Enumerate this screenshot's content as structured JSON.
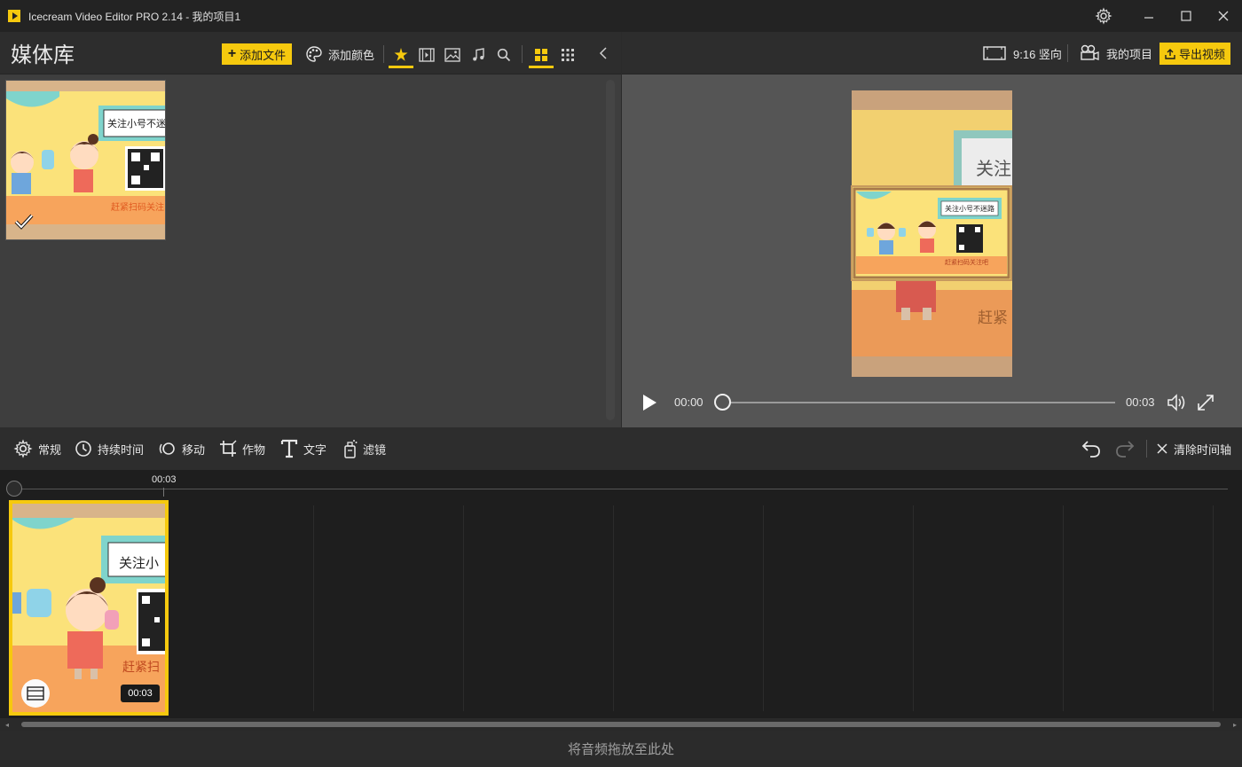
{
  "window": {
    "title": "Icecream Video Editor PRO 2.14 - 我的项目1",
    "controls": [
      "settings",
      "minimize",
      "maximize",
      "close"
    ]
  },
  "library": {
    "title": "媒体库",
    "add_file_label": "添加文件",
    "add_color_label": "添加颜色",
    "filters": [
      "all-star-icon",
      "video-icon",
      "image-icon",
      "music-icon",
      "search-icon"
    ],
    "active_filter": "all-star-icon",
    "views": [
      "large-grid-icon",
      "small-grid-icon"
    ],
    "active_view": "large-grid-icon",
    "items": [
      {
        "caption_top": "关注小号不迷",
        "caption_bottom": "赶紧扫码关注",
        "selected": true
      }
    ]
  },
  "preview": {
    "aspect_label": "9:16 竖向",
    "project_label": "我的项目",
    "export_label": "导出视频",
    "pip_caption_top": "关注小号不迷路",
    "pip_caption_bottom": "赶紧扫码关注吧",
    "bg_caption_top": "关注",
    "bg_caption_bottom": "赶紧",
    "time_current": "00:00",
    "time_total": "00:03",
    "progress": 0
  },
  "toolbar": {
    "general": "常规",
    "duration": "持续时间",
    "motion": "移动",
    "crop": "作物",
    "text": "文字",
    "filter": "滤镜",
    "clear_timeline": "清除时间轴"
  },
  "timeline": {
    "ruler_label": "00:03",
    "clip_caption_top": "关注小",
    "clip_caption_bottom": "赶紧扫",
    "clip_duration": "00:03",
    "audio_drop_hint": "将音频拖放至此处"
  },
  "colors": {
    "accent": "#f6c90e",
    "background": "#2b2b2b",
    "panel": "#3e3e3e",
    "preview_bg": "#555555",
    "timeline_bg": "#1e1e1e"
  }
}
